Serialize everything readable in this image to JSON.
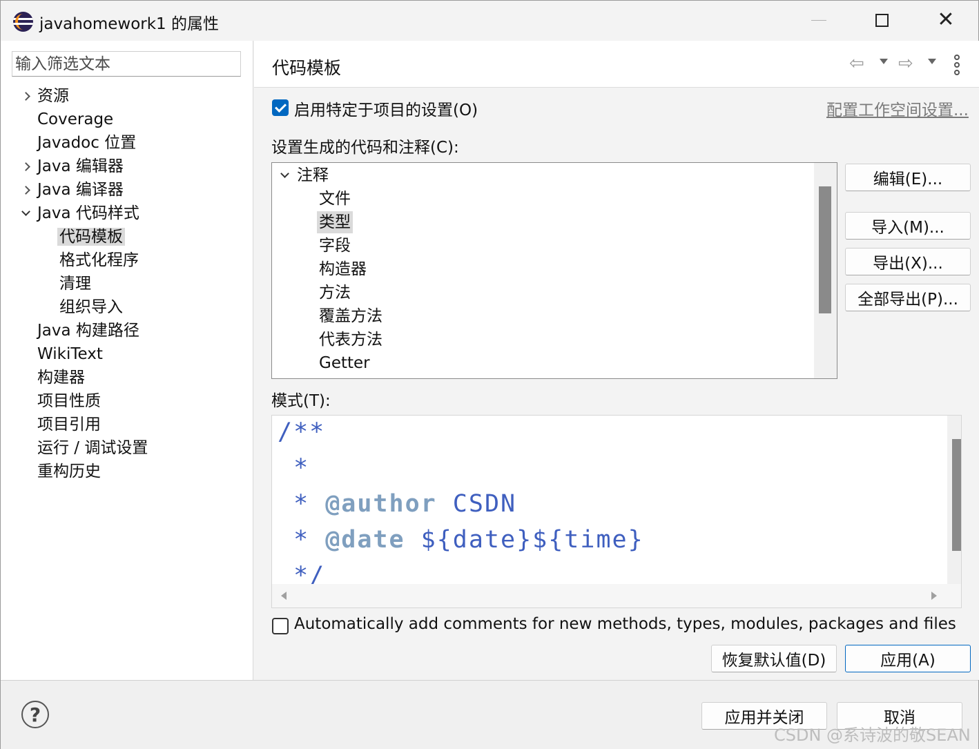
{
  "window": {
    "title": "javahomework1 的属性"
  },
  "left": {
    "filter_placeholder": "输入筛选文本",
    "tree": [
      {
        "label": "资源",
        "expander": "collapsed"
      },
      {
        "label": "Coverage",
        "expander": "none"
      },
      {
        "label": "Javadoc 位置",
        "expander": "none"
      },
      {
        "label": "Java 编辑器",
        "expander": "collapsed"
      },
      {
        "label": "Java 编译器",
        "expander": "collapsed"
      },
      {
        "label": "Java 代码样式",
        "expander": "expanded"
      },
      {
        "label": "代码模板",
        "expander": "none",
        "selected": true
      },
      {
        "label": "格式化程序",
        "expander": "none"
      },
      {
        "label": "清理",
        "expander": "none"
      },
      {
        "label": "组织导入",
        "expander": "none"
      },
      {
        "label": "Java 构建路径",
        "expander": "none"
      },
      {
        "label": "WikiText",
        "expander": "none"
      },
      {
        "label": "构建器",
        "expander": "none"
      },
      {
        "label": "项目性质",
        "expander": "none"
      },
      {
        "label": "项目引用",
        "expander": "none"
      },
      {
        "label": "运行 / 调试设置",
        "expander": "none"
      },
      {
        "label": "重构历史",
        "expander": "none"
      }
    ]
  },
  "page": {
    "title": "代码模板",
    "enable_project_settings": {
      "label": "启用特定于项目的设置(O)",
      "checked": true
    },
    "workspace_link": "配置工作空间设置...",
    "templates_label": "设置生成的代码和注释(C):",
    "templates_tree": {
      "root": "注释",
      "children": [
        "文件",
        "类型",
        "字段",
        "构造器",
        "方法",
        "覆盖方法",
        "代表方法",
        "Getter"
      ],
      "selected": "类型"
    },
    "buttons": {
      "edit": "编辑(E)...",
      "import": "导入(M)...",
      "export": "导出(X)...",
      "export_all": "全部导出(P)..."
    },
    "pattern_label": "模式(T):",
    "pattern_lines": {
      "l1": "/**",
      "l2": " *",
      "l3_prefix": " * ",
      "l3_tag": "@author",
      "l3_rest": " CSDN",
      "l4_prefix": " * ",
      "l4_tag": "@date",
      "l4_rest": " ${date}${time}",
      "l5": " */"
    },
    "auto_comments": {
      "label": "Automatically add comments for new methods, types, modules, packages and files",
      "checked": false
    },
    "restore_defaults": "恢复默认值(D)",
    "apply": "应用(A)"
  },
  "footer": {
    "apply_close": "应用并关闭",
    "cancel": "取消",
    "watermark": "CSDN @系诗波的敬SEAN"
  },
  "colors": {
    "accent": "#0067c0",
    "code_comment": "#3f5fbf",
    "code_tag": "#7f9fbf",
    "selection": "#dadada"
  }
}
